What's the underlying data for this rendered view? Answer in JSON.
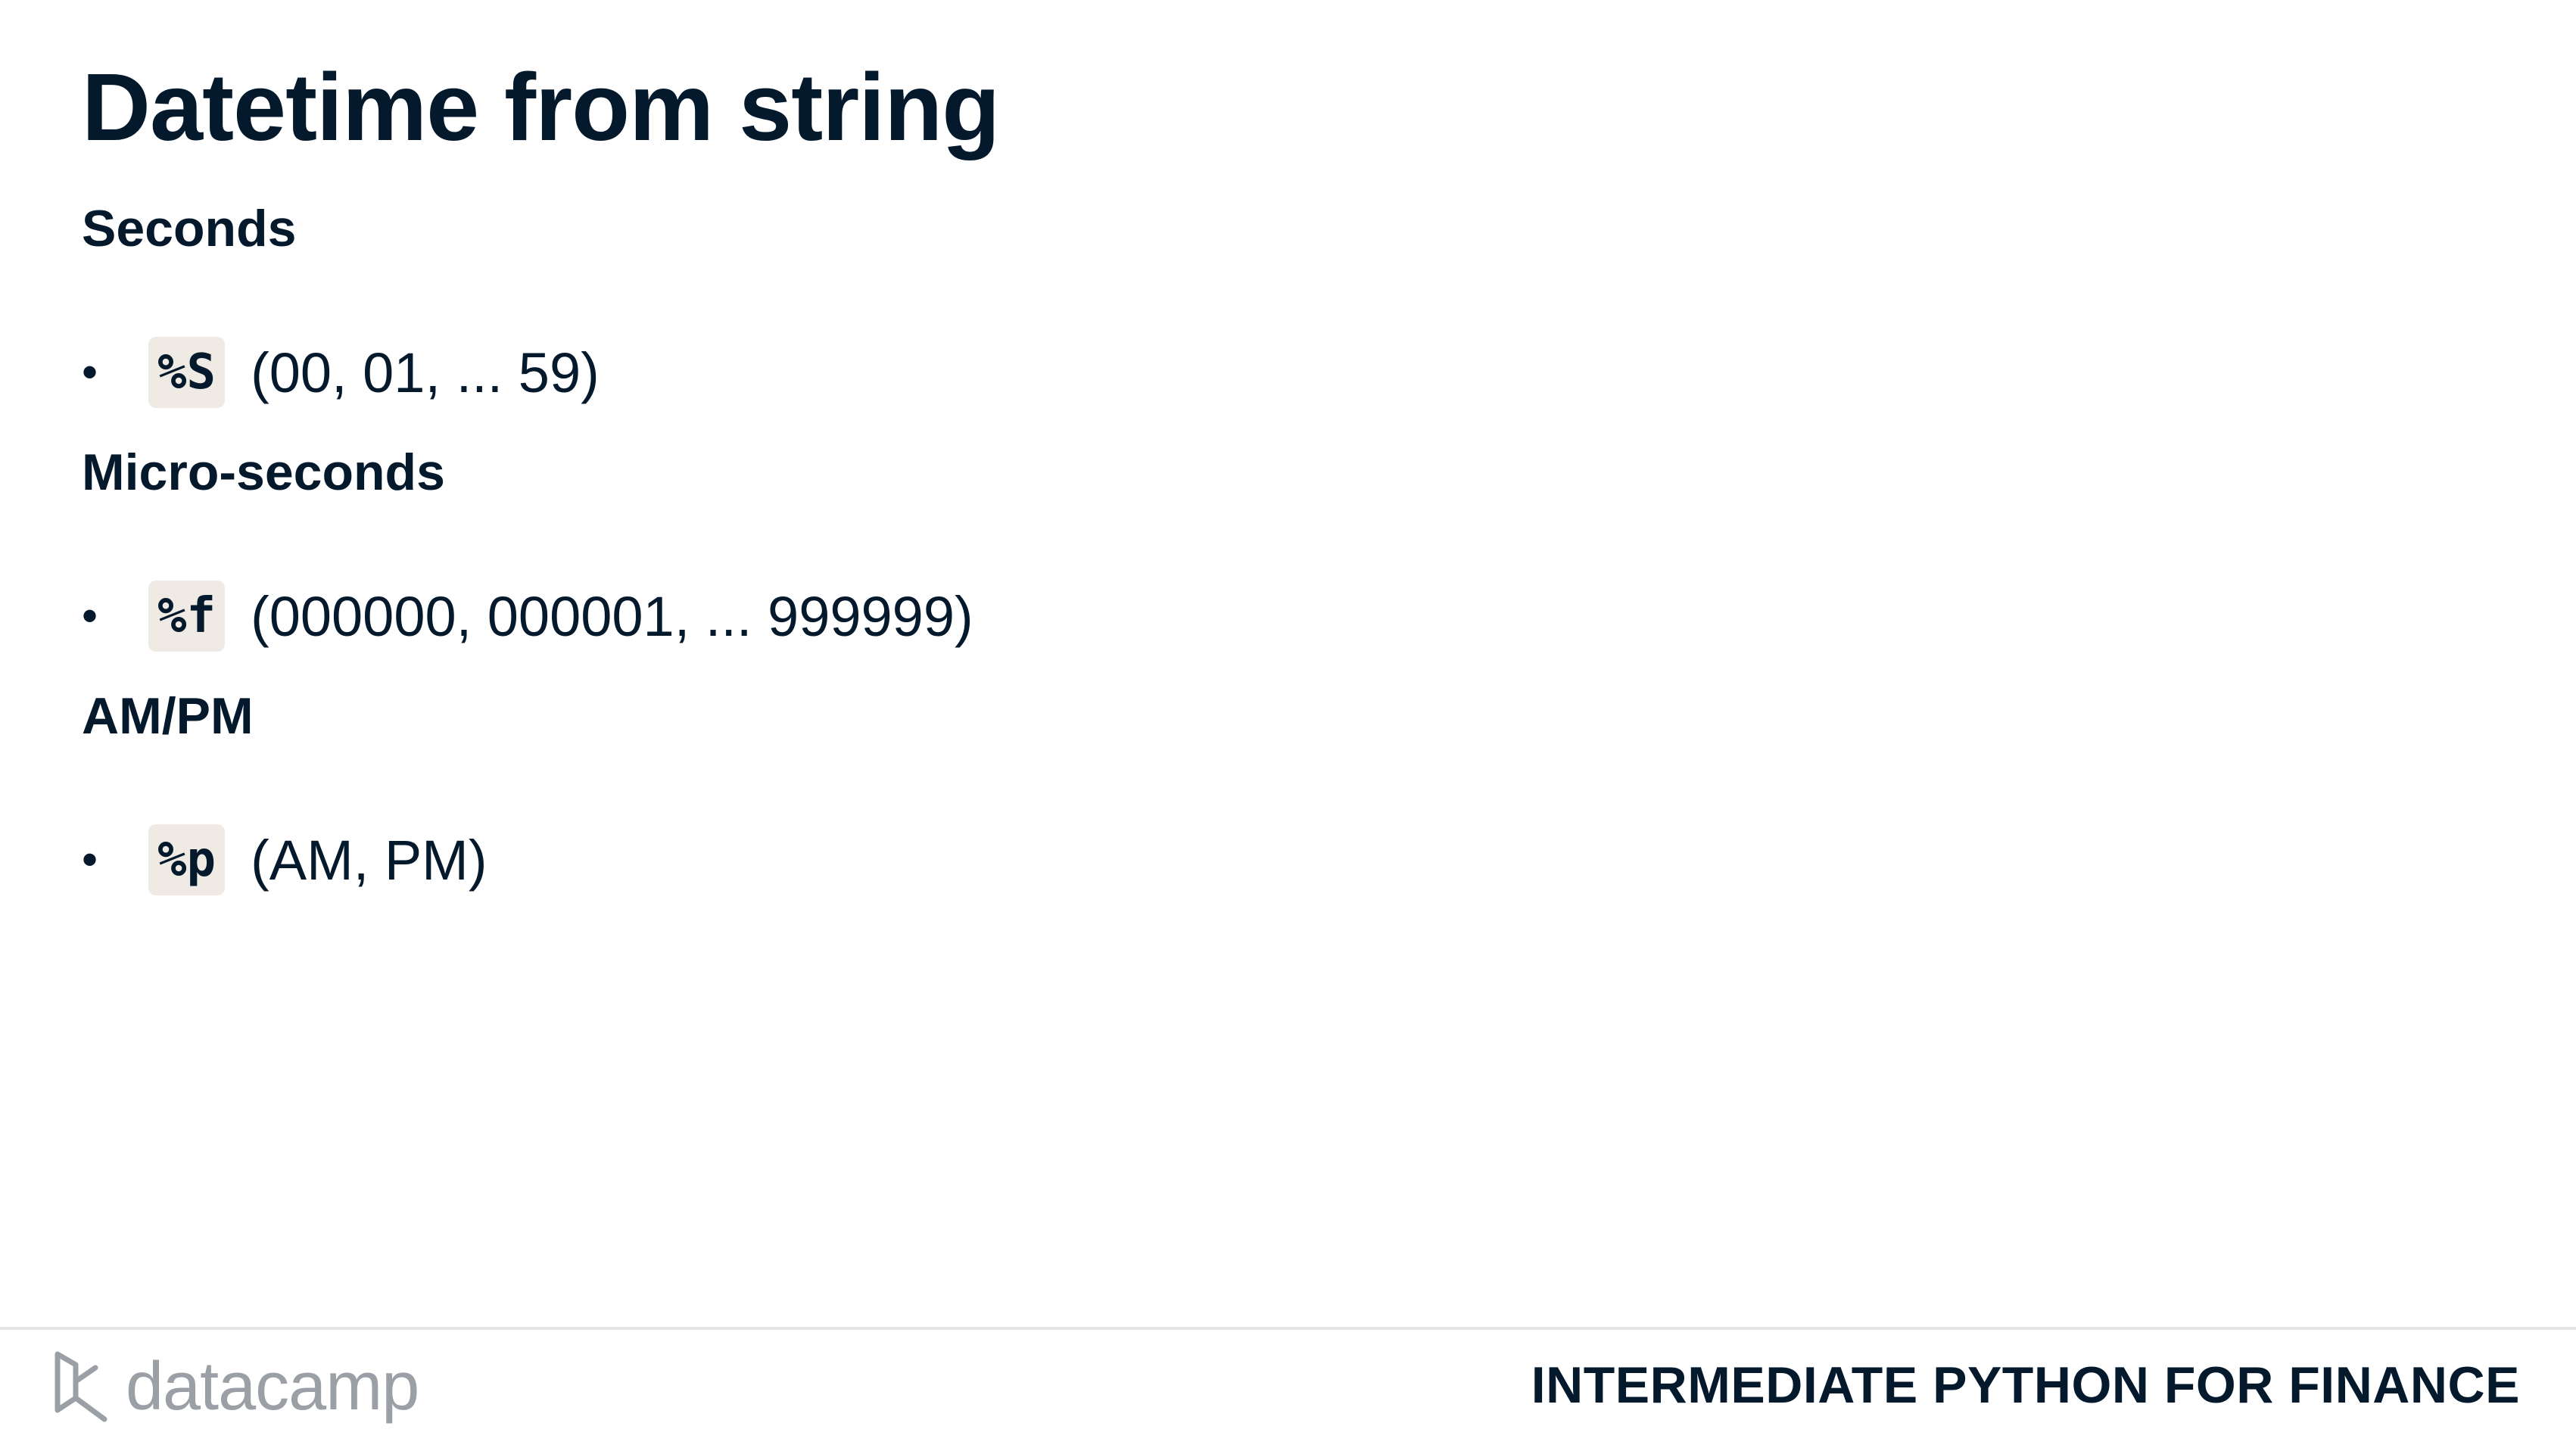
{
  "slide": {
    "title": "Datetime from string"
  },
  "sections": [
    {
      "heading": "Seconds",
      "code": "%S",
      "description": "(00, 01, ... 59)"
    },
    {
      "heading": "Micro-seconds",
      "code": "%f",
      "description": "(000000, 000001, ... 999999)"
    },
    {
      "heading": "AM/PM",
      "code": "%p",
      "description": "(AM, PM)"
    }
  ],
  "footer": {
    "logo_text": "datacamp",
    "course_name": "INTERMEDIATE PYTHON FOR FINANCE"
  },
  "colors": {
    "text": "#05192d",
    "code_background": "#efebe4",
    "logo_gray": "#9ba0a6",
    "divider": "#e6e6e6"
  }
}
